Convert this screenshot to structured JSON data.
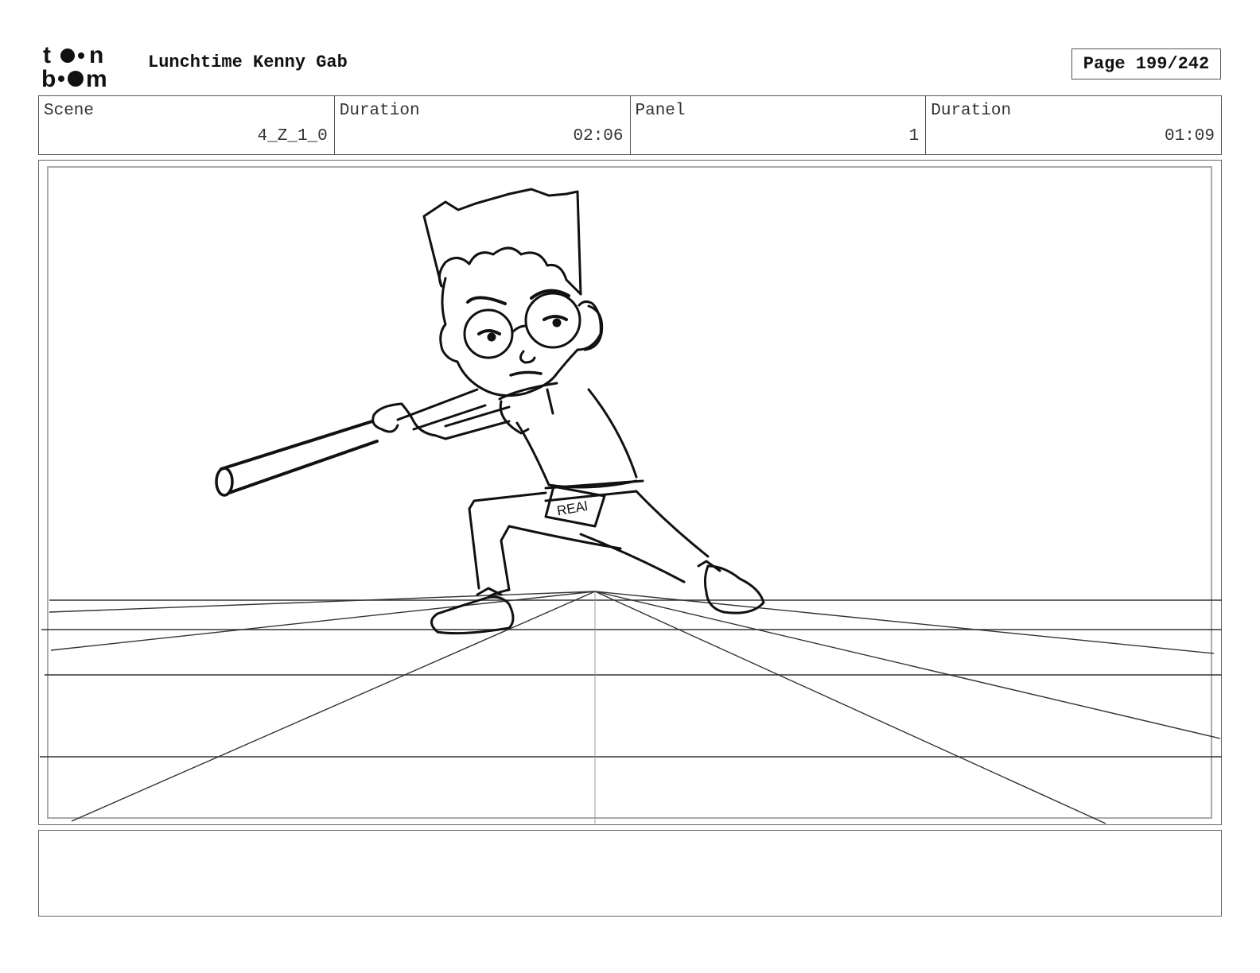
{
  "header": {
    "logo_text": "toon boom",
    "title": "Lunchtime Kenny Gab",
    "page_label": "Page 199/242"
  },
  "info": {
    "scene_label": "Scene",
    "scene_value": "4_Z_1_0",
    "scene_duration_label": "Duration",
    "scene_duration_value": "02:06",
    "panel_label": "Panel",
    "panel_value": "1",
    "panel_duration_label": "Duration",
    "panel_duration_value": "01:09"
  },
  "sketch": {
    "belt_text": "REAl"
  },
  "notes": {
    "text": ""
  }
}
